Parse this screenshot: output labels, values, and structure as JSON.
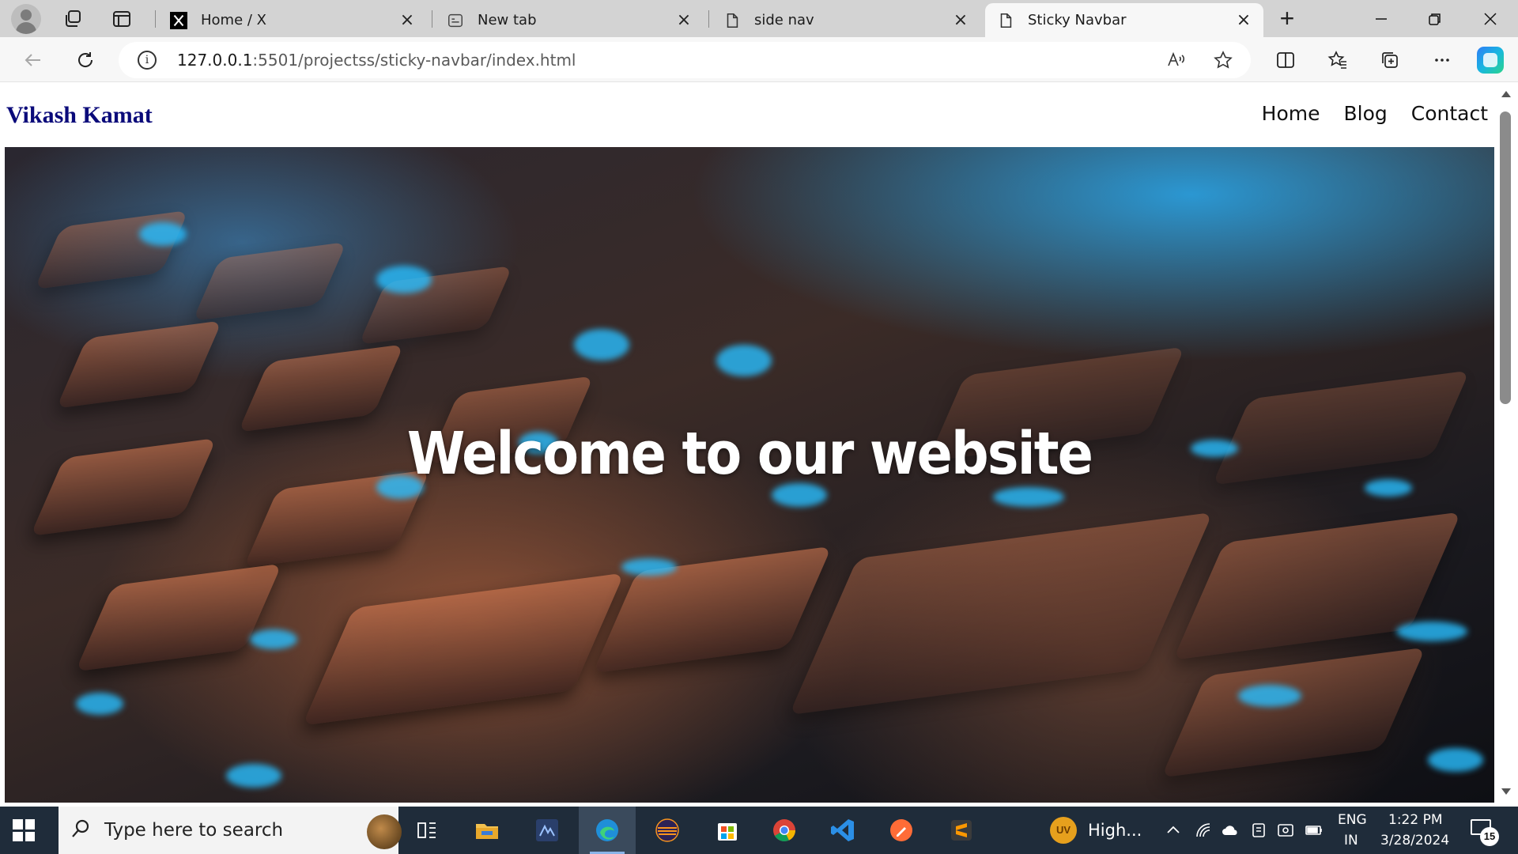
{
  "browser": {
    "tabs": [
      {
        "title": "Home / X",
        "icon": "x-logo-icon",
        "active": false
      },
      {
        "title": "New tab",
        "icon": "new-tab-page-icon",
        "active": false
      },
      {
        "title": "side nav",
        "icon": "document-icon",
        "active": false
      },
      {
        "title": "Sticky Navbar",
        "icon": "document-icon",
        "active": true
      }
    ],
    "new_tab_label": "+",
    "address": {
      "host": "127.0.0.1",
      "path": ":5501/projectss/sticky-navbar/index.html"
    }
  },
  "site": {
    "brand": "Vikash Kamat",
    "nav": [
      "Home",
      "Blog",
      "Contact"
    ],
    "hero_title": "Welcome to our website",
    "colors": {
      "brand": "#0a0a7a",
      "hero_text": "#ffffff"
    }
  },
  "taskbar": {
    "search_placeholder": "Type here to search",
    "weather_badge": "UV",
    "weather_text": "High...",
    "language": "ENG",
    "region": "IN",
    "time": "1:22 PM",
    "date": "3/28/2024",
    "notification_count": "15",
    "apps": [
      "task-view-icon",
      "file-explorer-icon",
      "app-icon",
      "edge-icon",
      "eclipse-icon",
      "microsoft-store-icon",
      "chrome-icon",
      "vscode-icon",
      "postman-icon",
      "sublime-text-icon"
    ]
  }
}
